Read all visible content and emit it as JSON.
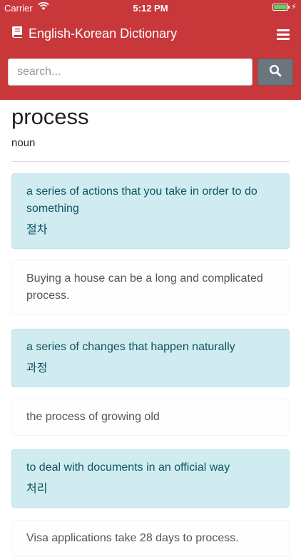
{
  "status_bar": {
    "carrier": "Carrier",
    "time": "5:12 PM"
  },
  "navbar": {
    "title": "English-Korean Dictionary",
    "brand_icon": "book-icon",
    "menu_icon": "hamburger-icon"
  },
  "search": {
    "placeholder": "search...",
    "button_icon": "search-icon"
  },
  "entry": {
    "word": "process",
    "part_of_speech": "noun",
    "senses": [
      {
        "definition": "a series of actions that you take in order to do something",
        "korean": "절차",
        "example": "Buying a house can be a long and complicated process."
      },
      {
        "definition": "a series of changes that happen naturally",
        "korean": "과정",
        "example": "the process of growing old"
      },
      {
        "definition": "to deal with documents in an official way",
        "korean": "처리",
        "example": "Visa applications take 28 days to process."
      }
    ]
  },
  "colors": {
    "header": "#c8383b",
    "definition_bg": "#d1ecf1",
    "definition_text": "#0c5460",
    "search_button": "#6c757d"
  }
}
